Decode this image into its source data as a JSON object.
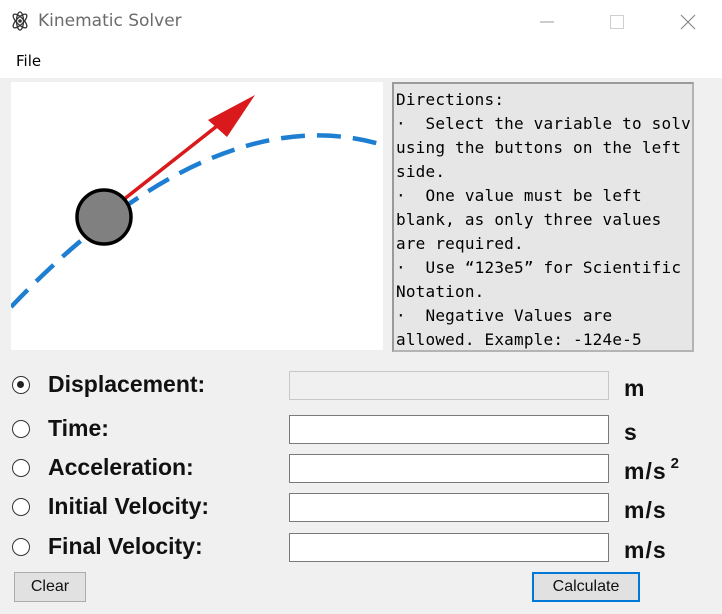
{
  "window": {
    "title": "Kinematic Solver",
    "app_icon": "atom-icon",
    "controls": [
      "minimize-icon",
      "maximize-icon",
      "close-icon"
    ]
  },
  "menu": {
    "file_label": "File"
  },
  "illustration": {
    "ball_color": "#808080",
    "arrow_color": "#d9191c",
    "trajectory_color": "#1e7fd2"
  },
  "directions": {
    "lines": [
      "Directions:",
      "·  Select the variable to solve",
      "using the buttons on the left",
      "side.",
      "·  One value must be left",
      "blank, as only three values",
      "are required.",
      "·  Use “123e5” for Scientific",
      "Notation.",
      "·  Negative Values are",
      "allowed. Example: -124e-5"
    ]
  },
  "variables": [
    {
      "label": "Displacement:",
      "unit": "m",
      "unit_sup": "",
      "selected": true,
      "value": ""
    },
    {
      "label": "Time:",
      "unit": "s",
      "unit_sup": "",
      "selected": false,
      "value": ""
    },
    {
      "label": "Acceleration:",
      "unit": "m/s",
      "unit_sup": "2",
      "selected": false,
      "value": ""
    },
    {
      "label": "Initial Velocity:",
      "unit": "m/s",
      "unit_sup": "",
      "selected": false,
      "value": ""
    },
    {
      "label": "Final Velocity:",
      "unit": "m/s",
      "unit_sup": "",
      "selected": false,
      "value": ""
    }
  ],
  "buttons": {
    "clear": "Clear",
    "calculate": "Calculate"
  },
  "colors": {
    "accent": "#0078d7"
  }
}
